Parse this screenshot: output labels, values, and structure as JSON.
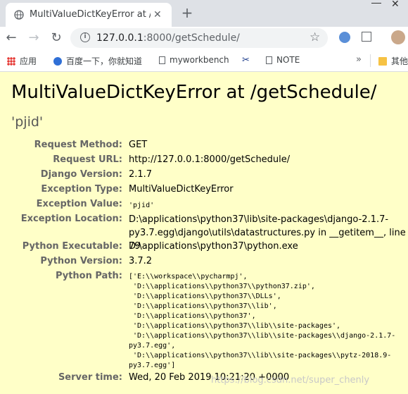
{
  "browser": {
    "tab_title": "MultiValueDictKeyError at /get",
    "url_host": "127.0.0.1",
    "url_rest": ":8000/getSchedule/",
    "bookmarks": [
      "应用",
      "百度一下，你就知道",
      "myworkbench",
      "NOTE",
      "其他"
    ],
    "more": "»"
  },
  "error": {
    "title": "MultiValueDictKeyError at /getSchedule/",
    "value": "'pjid'"
  },
  "meta": [
    {
      "label": "Request Method:",
      "value": "GET"
    },
    {
      "label": "Request URL:",
      "value": "http://127.0.0.1:8000/getSchedule/"
    },
    {
      "label": "Django Version:",
      "value": "2.1.7"
    },
    {
      "label": "Exception Type:",
      "value": "MultiValueDictKeyError"
    },
    {
      "label": "Exception Value:",
      "value": "'pjid'"
    },
    {
      "label": "Exception Location:",
      "value": "D:\\applications\\python37\\lib\\site-packages\\django-2.1.7-py3.7.egg\\django\\utils\\datastructures.py in __getitem__, line 79"
    },
    {
      "label": "Python Executable:",
      "value": "D:\\applications\\python37\\python.exe"
    },
    {
      "label": "Python Version:",
      "value": "3.7.2"
    },
    {
      "label": "Python Path:",
      "value": ""
    },
    {
      "label": "Server time:",
      "value": "Wed, 20 Feb 2019 10:21:20 +0000"
    }
  ],
  "python_path": [
    "['E:\\\\workspace\\\\pycharmpj',",
    " 'D:\\\\applications\\\\python37\\\\python37.zip',",
    " 'D:\\\\applications\\\\python37\\\\DLLs',",
    " 'D:\\\\applications\\\\python37\\\\lib',",
    " 'D:\\\\applications\\\\python37',",
    " 'D:\\\\applications\\\\python37\\\\lib\\\\site-packages',",
    " 'D:\\\\applications\\\\python37\\\\lib\\\\site-packages\\\\django-2.1.7-",
    "py3.7.egg',",
    " 'D:\\\\applications\\\\python37\\\\lib\\\\site-packages\\\\pytz-2018.9-",
    "py3.7.egg']"
  ],
  "watermark": "https://blog.csdn.net/super_chenly"
}
